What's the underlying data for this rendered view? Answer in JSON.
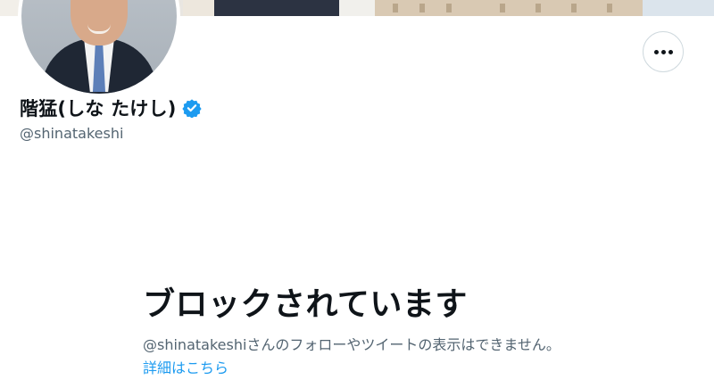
{
  "profile": {
    "display_name": "階猛(しな たけし)",
    "handle": "@shinatakeshi",
    "verified": true
  },
  "actions": {
    "more_icon": "ellipsis-icon"
  },
  "blocked": {
    "title": "ブロックされています",
    "message": "@shinatakeshiさんのフォローやツイートの表示はできません。",
    "link_text": "詳細はこちら"
  },
  "colors": {
    "accent": "#1d9bf0",
    "text_primary": "#0f1419",
    "text_secondary": "#536471",
    "border": "#cfd9de"
  }
}
